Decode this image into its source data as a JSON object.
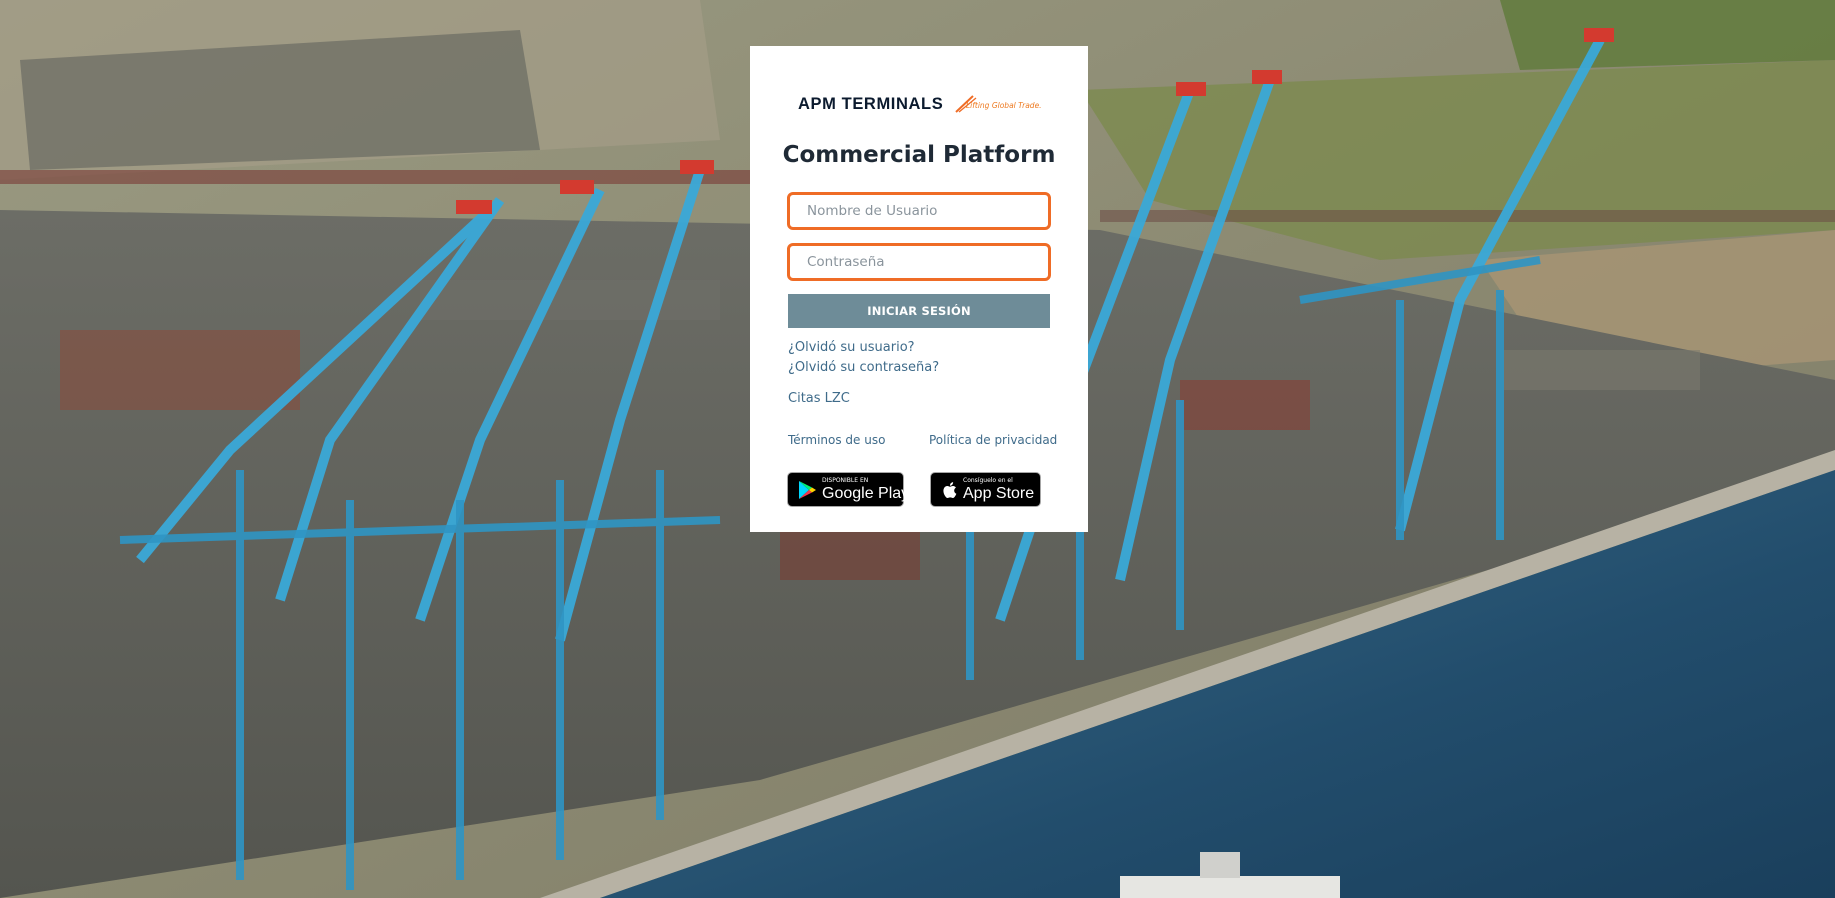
{
  "brand": {
    "name": "APM TERMINALS",
    "tagline": "Lifting Global Trade.",
    "accent_color": "#ef6c26",
    "name_color": "#0b1a2e"
  },
  "page": {
    "title": "Commercial Platform",
    "background_image": "aerial-port-container-cranes"
  },
  "login": {
    "username_placeholder": "Nombre de Usuario",
    "password_placeholder": "Contraseña",
    "username_value": "",
    "password_value": "",
    "submit_label": "INICIAR SESIÓN",
    "submit_color": "#6e8c98"
  },
  "links": {
    "forgot_user": "¿Olvidó su usuario?",
    "forgot_password": "¿Olvidó su contraseña?",
    "appointments": "Citas LZC",
    "terms": "Términos de uso",
    "privacy": "Política de privacidad",
    "link_color": "#3f6b8a"
  },
  "stores": {
    "google": {
      "small": "DISPONIBLE EN",
      "big": "Google Play",
      "icon": "google-play-icon"
    },
    "apple": {
      "small": "Consíguelo en el",
      "big": "App Store",
      "icon": "apple-icon"
    }
  }
}
